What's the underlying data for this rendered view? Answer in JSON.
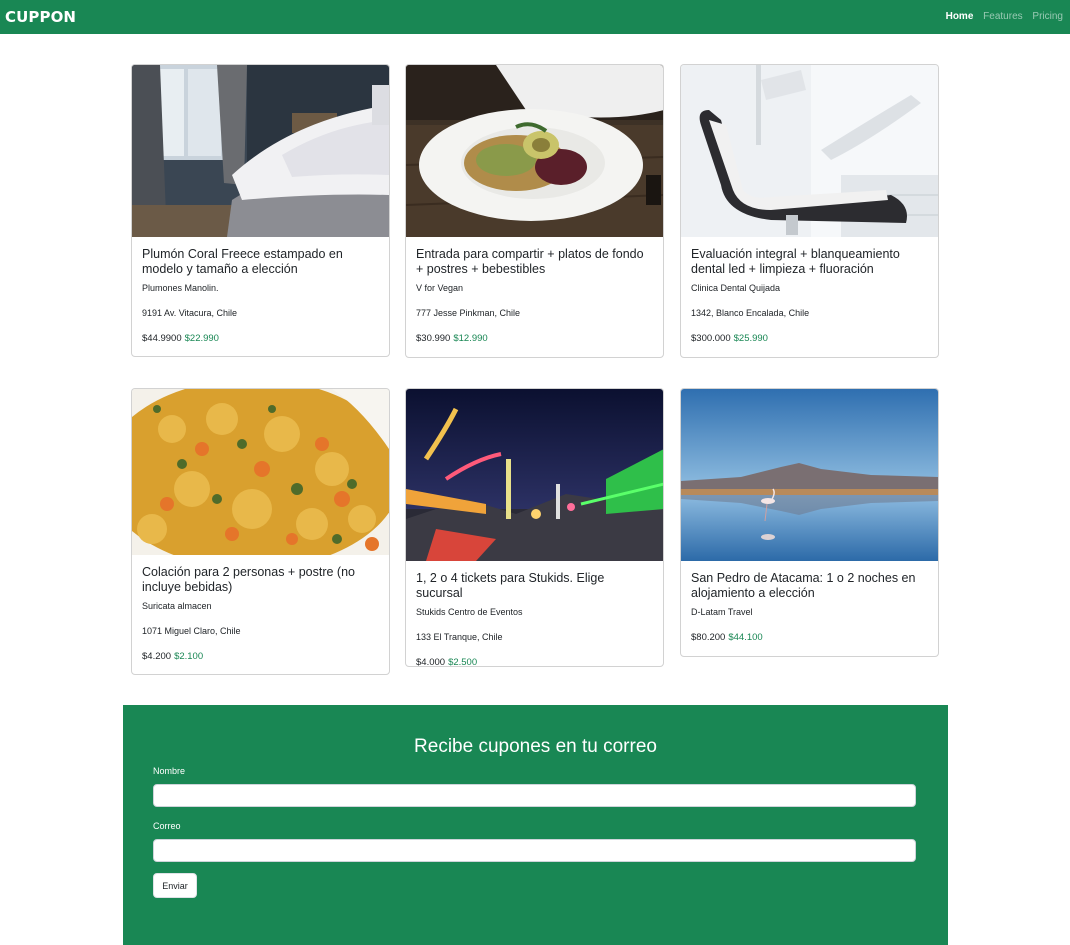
{
  "brand": "CUPPON",
  "nav": {
    "home": "Home",
    "features": "Features",
    "pricing": "Pricing"
  },
  "cards": [
    {
      "title": "Plumón Coral Freece estampado en modelo y tamaño a elección",
      "subtitle": "Plumones Manolin.",
      "address": "9191 Av. Vitacura, Chile",
      "price": "$44.9900",
      "deal": "$22.990",
      "image": "bedroom"
    },
    {
      "title": "Entrada para compartir + platos de fondo + postres + bebestibles",
      "subtitle": "V for Vegan",
      "address": "777 Jesse Pinkman, Chile",
      "price": "$30.990",
      "deal": "$12.990",
      "image": "salad-plate"
    },
    {
      "title": "Evaluación integral + blanqueamiento dental led + limpieza + fluoración",
      "subtitle": "Clinica Dental Quijada",
      "address": "1342, Blanco Encalada, Chile",
      "price": "$300.000",
      "deal": "$25.990",
      "image": "dental-chair"
    },
    {
      "title": "Colación para 2 personas + postre (no incluye bebidas)",
      "subtitle": "Suricata almacen",
      "address": "1071 Miguel Claro, Chile",
      "price": "$4.200",
      "deal": "$2.100",
      "image": "rice-dish"
    },
    {
      "title": "1, 2 o 4 tickets para Stukids. Elige sucursal",
      "subtitle": "Stukids Centro de Eventos",
      "address": "133 El Tranque, Chile",
      "price": "$4.000",
      "deal": "$2.500",
      "image": "fairground-night"
    },
    {
      "title": "San Pedro de Atacama: 1 o 2 noches en alojamiento a elección",
      "subtitle": "D-Latam Travel",
      "address": "",
      "price": "$80.200",
      "deal": "$44.100",
      "image": "salt-lake-flamingos"
    }
  ],
  "signup": {
    "heading": "Recibe cupones en tu correo",
    "name_label": "Nombre",
    "name_value": "",
    "email_label": "Correo",
    "email_value": "",
    "submit": "Enviar"
  }
}
